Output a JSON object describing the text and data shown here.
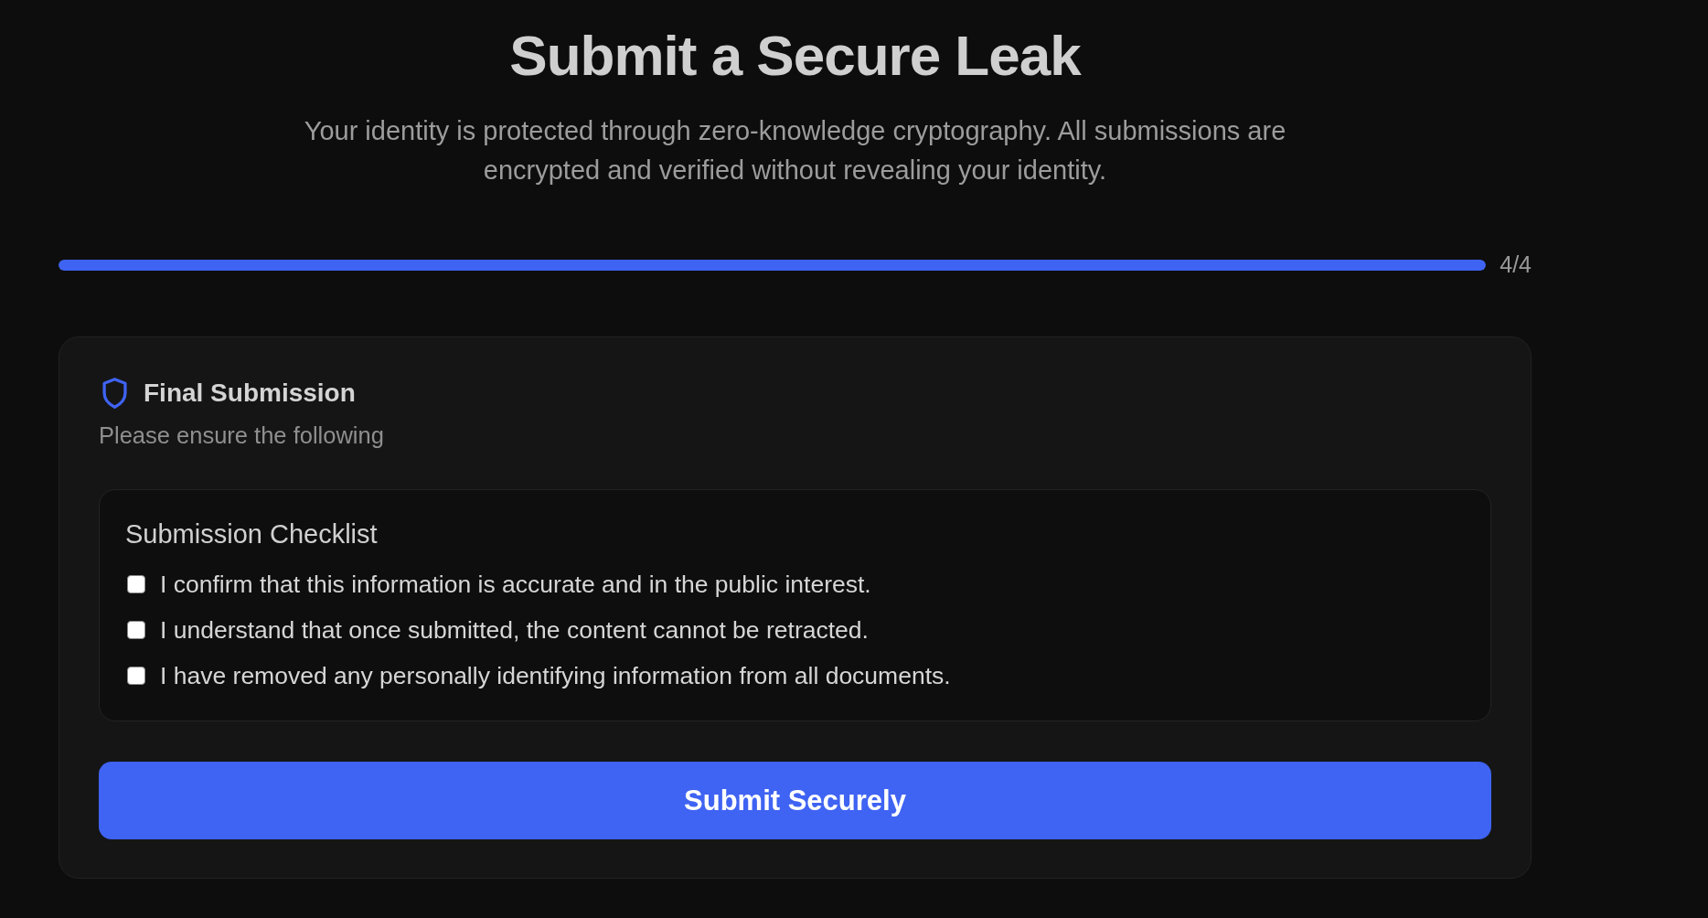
{
  "header": {
    "title": "Submit a Secure Leak",
    "subtitle": "Your identity is protected through zero-knowledge cryptography. All submissions are encrypted and verified without revealing your identity."
  },
  "progress": {
    "level": 1,
    "label": "4/4"
  },
  "card": {
    "title": "Final Submission",
    "subtitle": "Please ensure the following",
    "checklist": {
      "title": "Submission Checklist",
      "items": [
        {
          "label": "I confirm that this information is accurate and in the public interest.",
          "checked": false
        },
        {
          "label": "I understand that once submitted, the content cannot be retracted.",
          "checked": false
        },
        {
          "label": "I have removed any personally identifying information from all documents.",
          "checked": false
        }
      ]
    },
    "submit_button": "Submit Securely"
  }
}
